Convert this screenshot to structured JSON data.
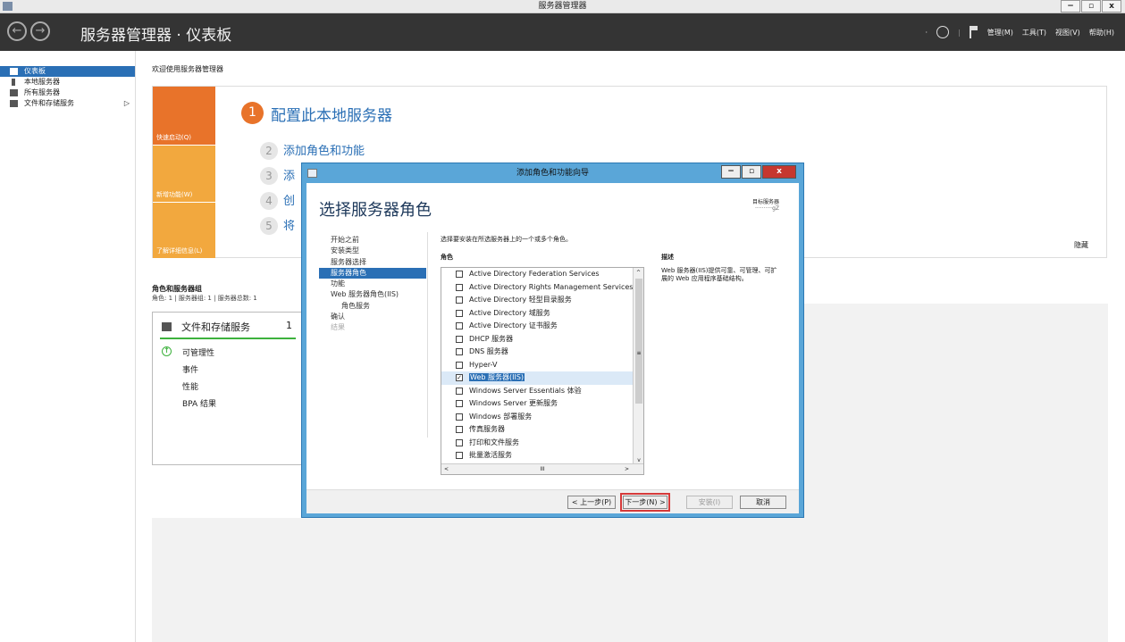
{
  "window": {
    "title": "服务器管理器",
    "controls": [
      "−",
      "▫",
      "x"
    ]
  },
  "header": {
    "breadcrumb": "服务器管理器 · 仪表板",
    "menu": [
      "管理(M)",
      "工具(T)",
      "视图(V)",
      "帮助(H)"
    ],
    "refresh_prefix": "·"
  },
  "sidebar": {
    "items": [
      {
        "label": "仪表板",
        "active": true
      },
      {
        "label": "本地服务器"
      },
      {
        "label": "所有服务器"
      },
      {
        "label": "文件和存储服务",
        "arrow": "▷"
      }
    ]
  },
  "welcome": "欢迎使用服务器管理器",
  "quickstart": {
    "tiles": [
      {
        "label": "快速启动(Q)",
        "color": "#e8732a"
      },
      {
        "label": "新增功能(W)",
        "color": "#f2a83e"
      },
      {
        "label": "了解详细信息(L)",
        "color": "#f2a83e"
      }
    ],
    "step1": {
      "num": "1",
      "text": "配置此本地服务器"
    },
    "steps": [
      {
        "num": "2",
        "text": "添加角色和功能"
      },
      {
        "num": "3",
        "text": "添"
      },
      {
        "num": "4",
        "text": "创"
      },
      {
        "num": "5",
        "text": "将"
      }
    ],
    "hide": "隐藏"
  },
  "roles_groups": {
    "title": "角色和服务器组",
    "subtitle": "角色: 1 | 服务器组: 1 | 服务器总数: 1",
    "card": {
      "name": "文件和存储服务",
      "count": "1",
      "rows": [
        "可管理性",
        "事件",
        "性能",
        "BPA 结果"
      ],
      "status_icon": "↑"
    }
  },
  "dialog": {
    "title": "添加角色和功能向导",
    "heading": "选择服务器角色",
    "target_label": "目标服务器",
    "target_value": "··········gZ",
    "steps": [
      {
        "label": "开始之前"
      },
      {
        "label": "安装类型"
      },
      {
        "label": "服务器选择"
      },
      {
        "label": "服务器角色",
        "active": true
      },
      {
        "label": "功能"
      },
      {
        "label": "Web 服务器角色(IIS)"
      },
      {
        "label": "角色服务",
        "sub": true
      },
      {
        "label": "确认"
      },
      {
        "label": "结果",
        "disabled": true
      }
    ],
    "instruction": "选择要安装在所选服务器上的一个或多个角色。",
    "roles_header": "角色",
    "roles": [
      {
        "label": "Active Directory Federation Services",
        "checked": false
      },
      {
        "label": "Active Directory Rights Management Services",
        "checked": false
      },
      {
        "label": "Active Directory 轻型目录服务",
        "checked": false
      },
      {
        "label": "Active Directory 域服务",
        "checked": false
      },
      {
        "label": "Active Directory 证书服务",
        "checked": false
      },
      {
        "label": "DHCP 服务器",
        "checked": false
      },
      {
        "label": "DNS 服务器",
        "checked": false
      },
      {
        "label": "Hyper-V",
        "checked": false
      },
      {
        "label": "Web 服务器(IIS)",
        "checked": true,
        "selected": true
      },
      {
        "label": "Windows Server Essentials 体验",
        "checked": false
      },
      {
        "label": "Windows Server 更新服务",
        "checked": false
      },
      {
        "label": "Windows 部署服务",
        "checked": false
      },
      {
        "label": "传真服务器",
        "checked": false
      },
      {
        "label": "打印和文件服务",
        "checked": false
      },
      {
        "label": "批量激活服务",
        "checked": false
      }
    ],
    "scroll": {
      "up": "^",
      "down": "v",
      "left": "<",
      "right": ">",
      "grip": "III",
      "vgrip": "≡"
    },
    "description_header": "描述",
    "description": "Web 服务器(IIS)提供可靠、可管理、可扩展的 Web 应用程序基础结构。",
    "buttons": {
      "prev": "< 上一步(P)",
      "next": "下一步(N) >",
      "install": "安装(I)",
      "cancel": "取消"
    },
    "controls": [
      "−",
      "▫",
      "x"
    ]
  },
  "colors": {
    "accent": "#2a6fb5",
    "header_bg": "#343434",
    "quick_orange": "#e8732a",
    "highlight": "#d63a3a"
  }
}
